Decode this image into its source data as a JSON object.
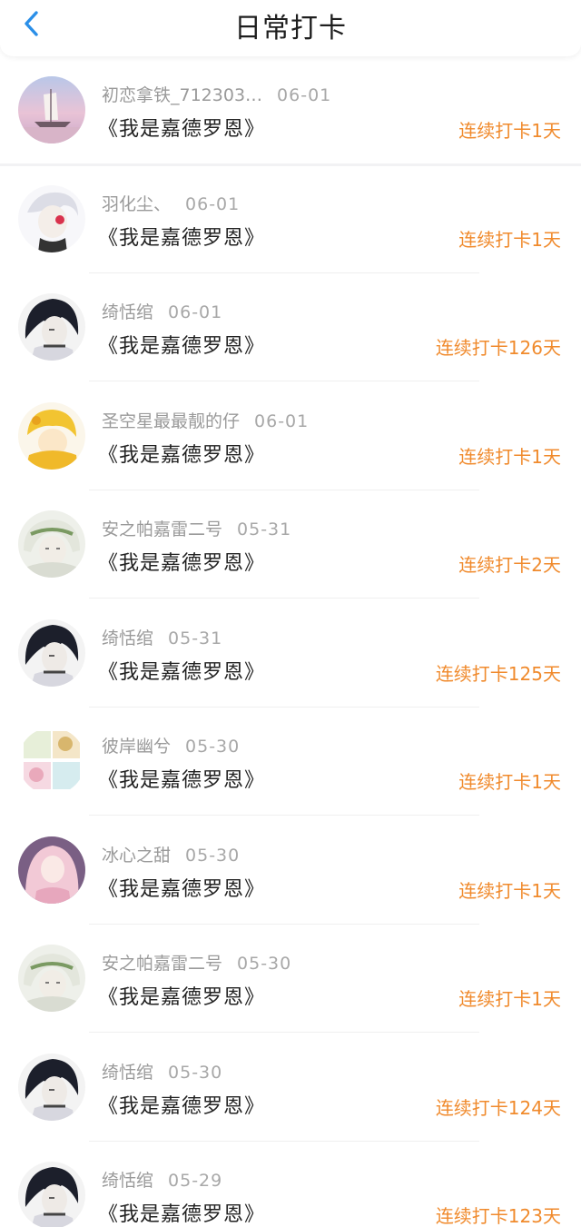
{
  "header": {
    "title": "日常打卡",
    "back_icon": "chevron-left-icon",
    "accent_color": "#2b8fe8"
  },
  "streak_color": "#f08a2c",
  "items": [
    {
      "user": "初恋拿铁_712303…",
      "date": "06-01",
      "book": "《我是嘉德罗恩》",
      "streak": "连续打卡1天",
      "avatar": "landscape"
    },
    {
      "user": "羽化尘、",
      "date": "06-01",
      "book": "《我是嘉德罗恩》",
      "streak": "连续打卡1天",
      "avatar": "white-hair"
    },
    {
      "user": "绮恬绾",
      "date": "06-01",
      "book": "《我是嘉德罗恩》",
      "streak": "连续打卡126天",
      "avatar": "dark-hair"
    },
    {
      "user": "圣空星最最靓的仔",
      "date": "06-01",
      "book": "《我是嘉德罗恩》",
      "streak": "连续打卡1天",
      "avatar": "yellow"
    },
    {
      "user": "安之帕嘉雷二号",
      "date": "05-31",
      "book": "《我是嘉德罗恩》",
      "streak": "连续打卡2天",
      "avatar": "green-hood"
    },
    {
      "user": "绮恬绾",
      "date": "05-31",
      "book": "《我是嘉德罗恩》",
      "streak": "连续打卡125天",
      "avatar": "dark-hair"
    },
    {
      "user": "彼岸幽兮",
      "date": "05-30",
      "book": "《我是嘉德罗恩》",
      "streak": "连续打卡1天",
      "avatar": "collage"
    },
    {
      "user": "冰心之甜",
      "date": "05-30",
      "book": "《我是嘉德罗恩》",
      "streak": "连续打卡1天",
      "avatar": "pink-hair"
    },
    {
      "user": "安之帕嘉雷二号",
      "date": "05-30",
      "book": "《我是嘉德罗恩》",
      "streak": "连续打卡1天",
      "avatar": "green-hood"
    },
    {
      "user": "绮恬绾",
      "date": "05-30",
      "book": "《我是嘉德罗恩》",
      "streak": "连续打卡124天",
      "avatar": "dark-hair"
    },
    {
      "user": "绮恬绾",
      "date": "05-29",
      "book": "《我是嘉德罗恩》",
      "streak": "连续打卡123天",
      "avatar": "dark-hair"
    }
  ]
}
